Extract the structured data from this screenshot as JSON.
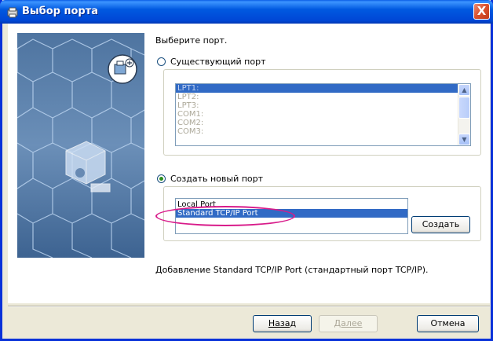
{
  "window": {
    "title": "Выбор порта",
    "close_symbol": "X"
  },
  "main": {
    "instruction": "Выберите порт.",
    "existing_port": {
      "label": "Существующий порт",
      "selected": false,
      "items": [
        "LPT1:",
        "LPT2:",
        "LPT3:",
        "COM1:",
        "COM2:",
        "COM3:"
      ],
      "selected_item": "LPT1:"
    },
    "new_port": {
      "label": "Создать новый порт",
      "selected": true,
      "items": [
        "Local Port",
        "Standard TCP/IP Port"
      ],
      "selected_item": "Standard TCP/IP Port",
      "create_button": "Создать"
    },
    "status_text": "Добавление Standard TCP/IP Port (стандартный порт TCP/IP)."
  },
  "footer": {
    "back_button": "Назад",
    "next_button": "Далее",
    "cancel_button": "Отмена"
  },
  "colors": {
    "titlebar": "#0058e6",
    "selection": "#316ac5",
    "annotation": "#d81b8a"
  },
  "icons": [
    "printer-app-icon",
    "close-icon",
    "printer-network-icon",
    "scroll-up-icon",
    "scroll-down-icon"
  ]
}
